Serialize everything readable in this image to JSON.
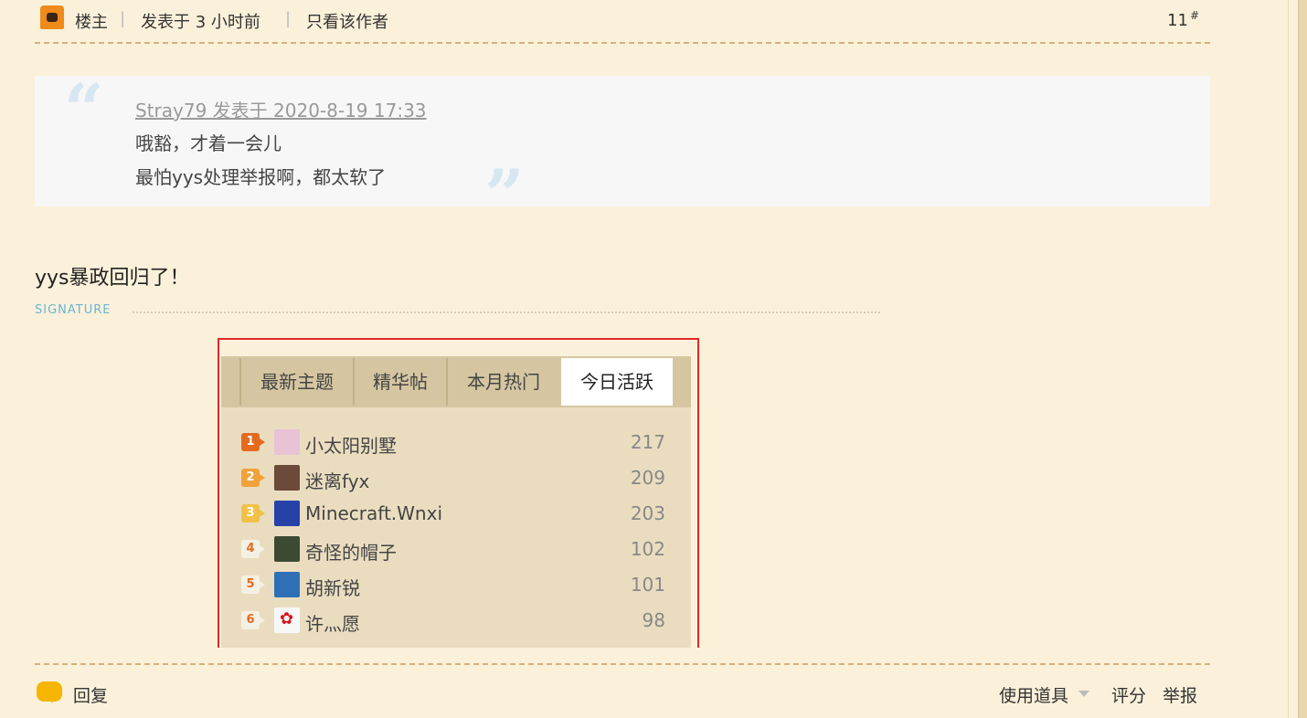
{
  "header": {
    "owner_label": "楼主",
    "posted_time": "发表于 3 小时前",
    "only_author": "只看该作者",
    "floor": "11",
    "floor_mark": "#"
  },
  "quote": {
    "author_line": "Stray79 发表于 2020-8-19 17:33",
    "lines": [
      "哦豁，才着一会儿",
      "最怕yys处理举报啊，都太软了"
    ],
    "open_mark": "“",
    "close_mark": "”"
  },
  "post_text": "yys暴政回归了！",
  "signature_label": "SIGNATURE",
  "signature_image": {
    "tabs": [
      "最新主题",
      "精华帖",
      "本月热门",
      "今日活跃"
    ],
    "active_tab": "今日活跃",
    "rows": [
      {
        "rank": "1",
        "name": "小太阳别墅",
        "score": "217",
        "badge_color": "#e46a20",
        "avatar_color": "#e7c3d5"
      },
      {
        "rank": "2",
        "name": "迷离fyx",
        "score": "209",
        "badge_color": "#f0a23a",
        "avatar_color": "#6b4a3a"
      },
      {
        "rank": "3",
        "name": "Minecraft.Wnxi",
        "score": "203",
        "badge_color": "#f2c04a",
        "avatar_color": "#2641a8"
      },
      {
        "rank": "4",
        "name": "奇怪的帽子",
        "score": "102",
        "badge_color": "#f4f0e4",
        "avatar_color": "#3c4a32"
      },
      {
        "rank": "5",
        "name": "胡新锐",
        "score": "101",
        "badge_color": "#f4f0e4",
        "avatar_color": "#2f6fb6"
      },
      {
        "rank": "6",
        "name": "许灬愿",
        "score": "98",
        "badge_color": "#f4f0e4",
        "avatar_color": "#f7f7f7"
      }
    ]
  },
  "footer": {
    "reply": "回复",
    "use_tool": "使用道具",
    "rate": "评分",
    "report": "举报"
  }
}
